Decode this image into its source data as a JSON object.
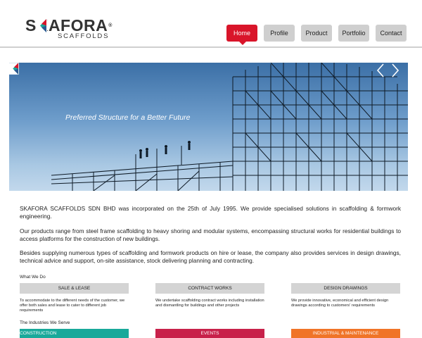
{
  "brand": {
    "name": "SKAFORA",
    "registered_mark": "®",
    "tagline": "SCAFFOLDS",
    "colors": {
      "primary_red": "#d9152a",
      "mark_teal": "#1aa79a",
      "mark_dark": "#333333"
    }
  },
  "nav": {
    "items": [
      {
        "label": "Home",
        "active": true
      },
      {
        "label": "Profile",
        "active": false
      },
      {
        "label": "Product",
        "active": false
      },
      {
        "label": "Portfolio",
        "active": false
      },
      {
        "label": "Contact",
        "active": false
      }
    ]
  },
  "banner": {
    "tagline": "Preferred Structure for a Better Future",
    "prev_icon": "chevron-left-icon",
    "next_icon": "chevron-right-icon"
  },
  "intro": {
    "paragraphs": [
      "SKAFORA SCAFFOLDS SDN BHD was incorporated on the 25th of July 1995. We provide specialised solutions in scaffolding & formwork engineering.",
      "Our products range from steel frame scaffolding to heavy shoring and modular systems, encompassing structural works for residential buildings to access platforms for the construction of new buildings.",
      "Besides supplying numerous types of scaffolding and formwork products on hire or lease, the company also provides services in design drawings, technical advice and support, on-site assistance, stock delivering planning and contracting."
    ]
  },
  "what_we_do": {
    "title": "What We Do",
    "services": [
      {
        "label": "SALE & LEASE",
        "description": "To accommodate to the different needs of the customer, we offer both sales and lease to cater to different job requirements"
      },
      {
        "label": "CONTRACT WORKS",
        "description": "We undertake scaffolding contract works including installation and dismantling for buildings and other projects"
      },
      {
        "label": "DESIGN DRAWINGS",
        "description": "We provide innovative, economical and efficient design drawings according to customers' requirements"
      }
    ]
  },
  "industries": {
    "title": "The Industries We Serve",
    "items": [
      {
        "label": "CONSTRUCTION",
        "color": "#19a99a"
      },
      {
        "label": "EVENTS",
        "color": "#c8214a"
      },
      {
        "label": "INDUSTRIAL & MAINTENANCE",
        "color": "#f07428"
      }
    ]
  }
}
